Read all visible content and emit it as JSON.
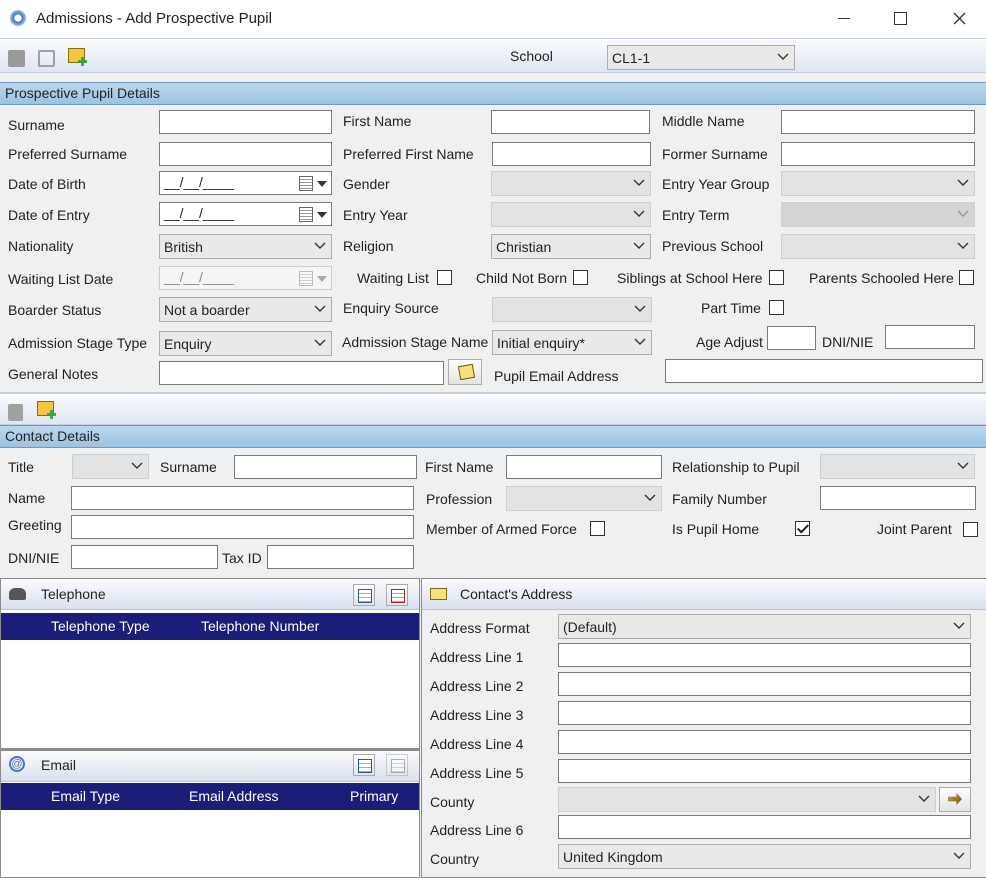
{
  "window": {
    "title": "Admissions - Add Prospective Pupil"
  },
  "toolbar": {
    "school_label": "School",
    "school_value": "CL1-1"
  },
  "pupil": {
    "section_title": "Prospective Pupil Details",
    "surname": "Surname",
    "first_name": "First Name",
    "middle_name": "Middle Name",
    "preferred_surname": "Preferred Surname",
    "preferred_first_name": "Preferred First Name",
    "former_surname": "Former Surname",
    "dob": "Date of Birth",
    "date_placeholder": "__/__/____",
    "gender": "Gender",
    "entry_year_group": "Entry Year Group",
    "date_of_entry": "Date of Entry",
    "entry_year": "Entry Year",
    "entry_term": "Entry Term",
    "nationality": "Nationality",
    "nationality_value": "British",
    "religion": "Religion",
    "religion_value": "Christian",
    "previous_school": "Previous School",
    "waiting_list_date": "Waiting List Date",
    "waiting_list": "Waiting List",
    "child_not_born": "Child Not Born",
    "siblings": "Siblings at School Here",
    "parents_schooled": "Parents Schooled Here",
    "boarder_status": "Boarder Status",
    "boarder_value": "Not a boarder",
    "enquiry_source": "Enquiry Source",
    "part_time": "Part Time",
    "stage_type": "Admission Stage Type",
    "stage_type_value": "Enquiry",
    "stage_name": "Admission Stage Name",
    "stage_name_value": "Initial enquiry*",
    "age_adjust": "Age Adjust",
    "dni_nie": "DNI/NIE",
    "general_notes": "General Notes",
    "pupil_email": "Pupil Email Address"
  },
  "contact": {
    "section_title": "Contact Details",
    "title": "Title",
    "surname": "Surname",
    "first_name": "First Name",
    "relationship": "Relationship to Pupil",
    "name": "Name",
    "profession": "Profession",
    "family_number": "Family Number",
    "greeting": "Greeting",
    "armed_force": "Member of Armed Force",
    "is_pupil_home": "Is Pupil Home",
    "joint_parent": "Joint Parent",
    "dni_nie": "DNI/NIE",
    "tax_id": "Tax ID"
  },
  "telephone": {
    "title": "Telephone",
    "col_type": "Telephone Type",
    "col_number": "Telephone Number"
  },
  "email": {
    "title": "Email",
    "col_type": "Email Type",
    "col_address": "Email Address",
    "col_primary": "Primary"
  },
  "address": {
    "title": "Contact's Address",
    "format": "Address Format",
    "format_value": "(Default)",
    "line1": "Address Line 1",
    "line2": "Address Line 2",
    "line3": "Address Line 3",
    "line4": "Address Line 4",
    "line5": "Address Line 5",
    "county": "County",
    "line6": "Address Line 6",
    "country": "Country",
    "country_value": "United Kingdom"
  }
}
